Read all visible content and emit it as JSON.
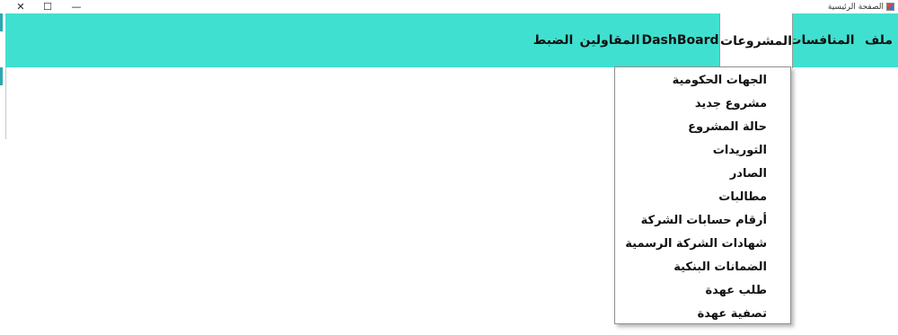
{
  "window": {
    "title": "الصفحة الرئيسية",
    "icon": "app-icon",
    "controls": {
      "close": "✕",
      "maximize": "☐",
      "minimize": "—"
    }
  },
  "menubar": {
    "background": "#40e0d0",
    "items": [
      {
        "label": "ملف"
      },
      {
        "label": "المنافسات"
      },
      {
        "label": "المشروعات",
        "open": true
      },
      {
        "label": "DashBoard"
      },
      {
        "label": "المقاولين"
      },
      {
        "label": "الضبط"
      }
    ]
  },
  "projects_menu": {
    "items": [
      {
        "label": "الجهات الحكومية"
      },
      {
        "label": "مشروع جديد"
      },
      {
        "label": "حالة المشروع"
      },
      {
        "label": "التوريدات"
      },
      {
        "label": "الصادر"
      },
      {
        "label": "مطالبات"
      },
      {
        "label": "أرقام حسابات الشركة"
      },
      {
        "label": "شهادات الشركة الرسمية"
      },
      {
        "label": "الضمانات البنكية"
      },
      {
        "label": "طلب عهدة"
      },
      {
        "label": "تصفية عهدة"
      }
    ]
  }
}
